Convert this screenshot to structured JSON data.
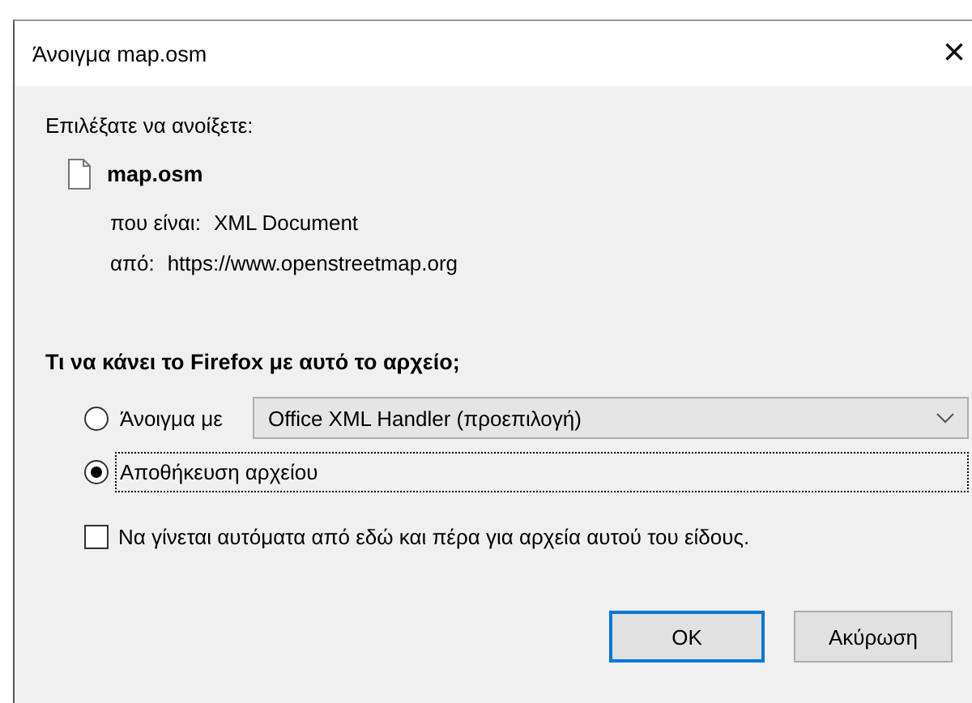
{
  "window": {
    "title": "Άνοιγμα map.osm",
    "close": "×"
  },
  "intro": "Επιλέξατε να ανοίξετε:",
  "file": {
    "name": "map.osm",
    "details": [
      {
        "label": "που είναι:",
        "value": "XML Document"
      },
      {
        "label": "από:",
        "value": "https://www.openstreetmap.org"
      }
    ]
  },
  "question": "Τι να κάνει το Firefox με αυτό το αρχείο;",
  "options": [
    {
      "kind": "open-with",
      "label": "Άνοιγμα με",
      "selected": false,
      "handler": "Office XML Handler (προεπιλογή)",
      "focused": false
    },
    {
      "kind": "plain",
      "label": "Αποθήκευση αρχείου",
      "selected": true,
      "focused": true
    }
  ],
  "remember": {
    "label": "Να γίνεται αυτόματα από εδώ και πέρα για αρχεία αυτού του είδους.",
    "checked": false
  },
  "buttons": [
    {
      "label": "OK",
      "default": true
    },
    {
      "label": "Ακύρωση",
      "default": false
    }
  ]
}
